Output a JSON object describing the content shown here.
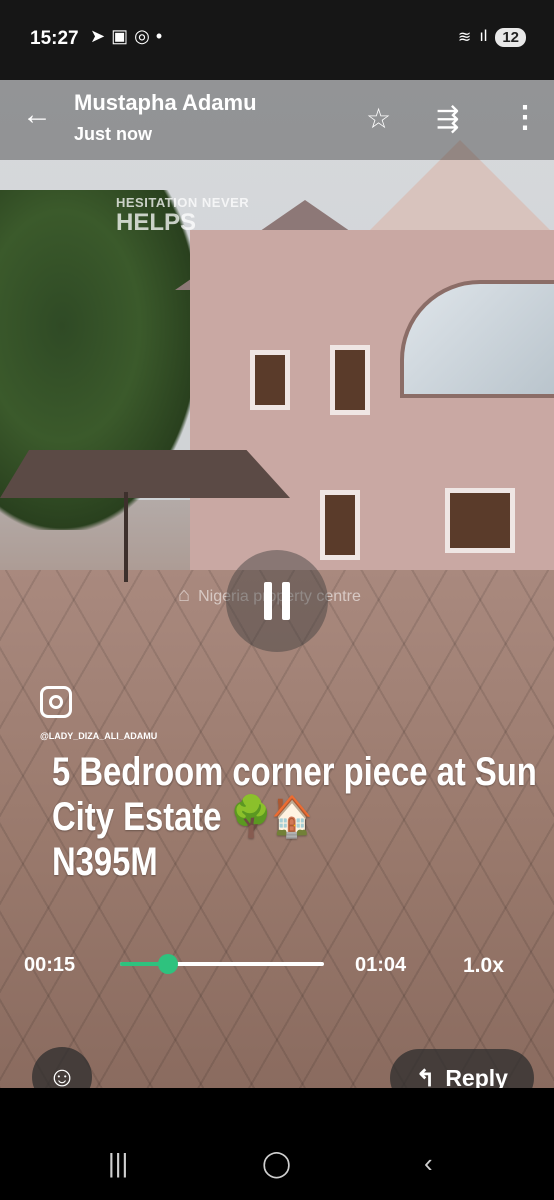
{
  "status_bar": {
    "time": "15:27",
    "icons": [
      "telegram-icon",
      "screenshot-icon",
      "whatsapp-icon",
      "dot-icon"
    ],
    "battery": "12"
  },
  "header": {
    "sender": "Mustapha Adamu",
    "timestamp": "Just now"
  },
  "video": {
    "overlay_title_1": "HESITATION NEVER",
    "overlay_title_2": "HELPS",
    "watermark": "Nigeria property centre",
    "handle": "@LADY_DIZA_ALI_ADAMU",
    "caption_lines": [
      "5 Bedroom corner piece at Sun",
      "City Estate 🌳🏠",
      "N395M"
    ]
  },
  "playback": {
    "elapsed": "00:15",
    "duration": "01:04",
    "speed": "1.0x",
    "progress": 0.234
  },
  "actions": {
    "reply_label": "Reply"
  },
  "colors": {
    "accent": "#2ec27e",
    "status_bar_bg": "#161616"
  }
}
